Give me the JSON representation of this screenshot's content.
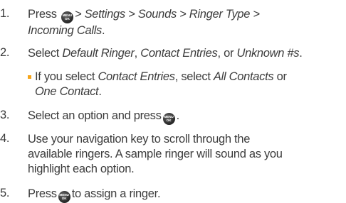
{
  "steps": [
    {
      "num": "1.",
      "pre": "Press",
      "path1": "> Settings > Sounds > Ringer Type >",
      "path2": "Incoming Calls",
      "post": "."
    },
    {
      "num": "2.",
      "a": "Select ",
      "b": "Default Ringer",
      "c": ", ",
      "d": "Contact Entries",
      "e": ", or ",
      "f": "Unknown #s",
      "g": "."
    },
    {
      "num": "3.",
      "pre": "Select an option and press",
      "post": "."
    },
    {
      "num": "4.",
      "line1": "Use your navigation key to scroll through the",
      "line2": "available ringers. A sample ringer will sound as you",
      "line3": "highlight each option."
    },
    {
      "num": "5.",
      "pre": "Press",
      "post": "to assign a ringer."
    }
  ],
  "bullet": {
    "a": "If you select ",
    "b": "Contact Entries",
    "c": ", select ",
    "d": "All Contacts",
    "e": " or",
    "f": "One Contact",
    "g": "."
  },
  "menu_button": {
    "icon": "menu-ok-button-icon",
    "top": "MENU",
    "bottom": "OK"
  },
  "colors": {
    "text": "#3c3c3c",
    "bullet": "#f6a51b"
  }
}
